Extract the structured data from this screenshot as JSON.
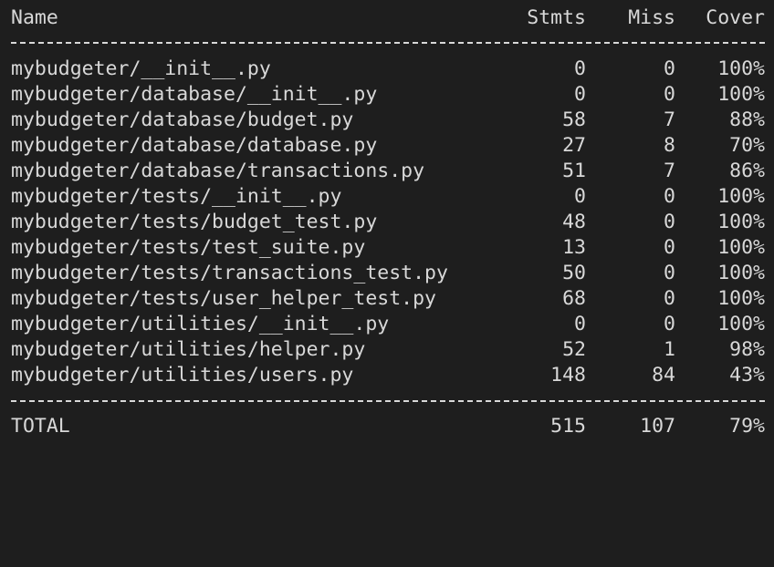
{
  "terminal": {
    "clipped_line": "… … … … … … … … … … … … … … … … … … … … … …",
    "headers": {
      "name": "Name",
      "stmts": "Stmts",
      "miss": "Miss",
      "cover": "Cover"
    },
    "rows": [
      {
        "name": "mybudgeter/__init__.py",
        "stmts": "0",
        "miss": "0",
        "cover": "100%"
      },
      {
        "name": "mybudgeter/database/__init__.py",
        "stmts": "0",
        "miss": "0",
        "cover": "100%"
      },
      {
        "name": "mybudgeter/database/budget.py",
        "stmts": "58",
        "miss": "7",
        "cover": "88%"
      },
      {
        "name": "mybudgeter/database/database.py",
        "stmts": "27",
        "miss": "8",
        "cover": "70%"
      },
      {
        "name": "mybudgeter/database/transactions.py",
        "stmts": "51",
        "miss": "7",
        "cover": "86%"
      },
      {
        "name": "mybudgeter/tests/__init__.py",
        "stmts": "0",
        "miss": "0",
        "cover": "100%"
      },
      {
        "name": "mybudgeter/tests/budget_test.py",
        "stmts": "48",
        "miss": "0",
        "cover": "100%"
      },
      {
        "name": "mybudgeter/tests/test_suite.py",
        "stmts": "13",
        "miss": "0",
        "cover": "100%"
      },
      {
        "name": "mybudgeter/tests/transactions_test.py",
        "stmts": "50",
        "miss": "0",
        "cover": "100%"
      },
      {
        "name": "mybudgeter/tests/user_helper_test.py",
        "stmts": "68",
        "miss": "0",
        "cover": "100%"
      },
      {
        "name": "mybudgeter/utilities/__init__.py",
        "stmts": "0",
        "miss": "0",
        "cover": "100%"
      },
      {
        "name": "mybudgeter/utilities/helper.py",
        "stmts": "52",
        "miss": "1",
        "cover": "98%"
      },
      {
        "name": "mybudgeter/utilities/users.py",
        "stmts": "148",
        "miss": "84",
        "cover": "43%"
      }
    ],
    "total": {
      "name": "TOTAL",
      "stmts": "515",
      "miss": "107",
      "cover": "79%"
    }
  }
}
